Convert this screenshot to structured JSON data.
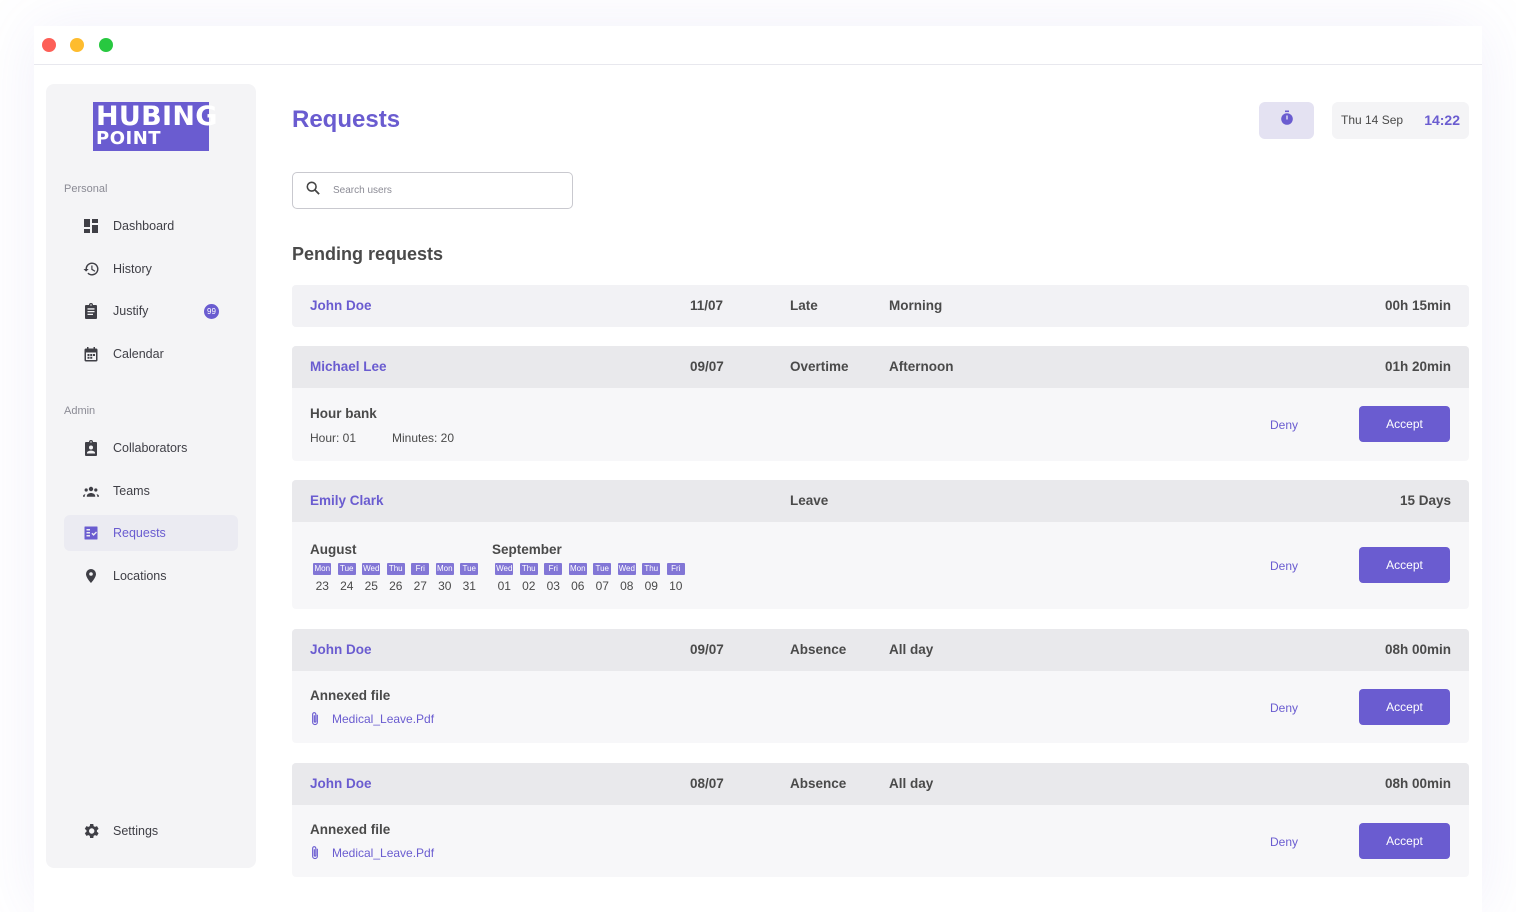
{
  "brand": {
    "line1": "HUBING",
    "line2": "POINT",
    "accent": "#6a5cd0"
  },
  "sidebar": {
    "personal_label": "Personal",
    "admin_label": "Admin",
    "personal_items": [
      {
        "label": "Dashboard",
        "icon": "dashboard-icon"
      },
      {
        "label": "History",
        "icon": "history-icon"
      },
      {
        "label": "Justify",
        "icon": "clipboard-icon",
        "badge": "99"
      },
      {
        "label": "Calendar",
        "icon": "calendar-icon"
      }
    ],
    "admin_items": [
      {
        "label": "Collaborators",
        "icon": "collaborators-icon"
      },
      {
        "label": "Teams",
        "icon": "teams-icon"
      },
      {
        "label": "Requests",
        "icon": "requests-icon",
        "active": true
      },
      {
        "label": "Locations",
        "icon": "location-pin-icon"
      }
    ],
    "settings_label": "Settings"
  },
  "header": {
    "title": "Requests",
    "date": "Thu 14 Sep",
    "time": "14:22"
  },
  "search": {
    "placeholder": "Search users",
    "value": ""
  },
  "pending": {
    "title": "Pending requests",
    "deny_label": "Deny",
    "accept_label": "Accept",
    "requests": [
      {
        "name": "John Doe",
        "date": "11/07",
        "type": "Late",
        "period": "Morning",
        "duration": "00h 15min"
      },
      {
        "name": "Michael Lee",
        "date": "09/07",
        "type": "Overtime",
        "period": "Afternoon",
        "duration": "01h 20min",
        "detail_title": "Hour bank",
        "hour": "Hour: 01",
        "minutes": "Minutes: 20"
      },
      {
        "name": "Emily Clark",
        "type": "Leave",
        "duration": "15 Days",
        "months": [
          {
            "name": "August",
            "days": [
              {
                "dn": "Mon",
                "d": "23"
              },
              {
                "dn": "Tue",
                "d": "24"
              },
              {
                "dn": "Wed",
                "d": "25"
              },
              {
                "dn": "Thu",
                "d": "26"
              },
              {
                "dn": "Fri",
                "d": "27"
              },
              {
                "dn": "Mon",
                "d": "30"
              },
              {
                "dn": "Tue",
                "d": "31"
              }
            ]
          },
          {
            "name": "September",
            "days": [
              {
                "dn": "Wed",
                "d": "01"
              },
              {
                "dn": "Thu",
                "d": "02"
              },
              {
                "dn": "Fri",
                "d": "03"
              },
              {
                "dn": "Mon",
                "d": "06"
              },
              {
                "dn": "Tue",
                "d": "07"
              },
              {
                "dn": "Wed",
                "d": "08"
              },
              {
                "dn": "Thu",
                "d": "09"
              },
              {
                "dn": "Fri",
                "d": "10"
              }
            ]
          }
        ]
      },
      {
        "name": "John Doe",
        "date": "09/07",
        "type": "Absence",
        "period": "All day",
        "duration": "08h 00min",
        "detail_title": "Annexed file",
        "file": "Medical_Leave.Pdf"
      },
      {
        "name": "John Doe",
        "date": "08/07",
        "type": "Absence",
        "period": "All day",
        "duration": "08h 00min",
        "detail_title": "Annexed file",
        "file": "Medical_Leave.Pdf"
      }
    ]
  }
}
